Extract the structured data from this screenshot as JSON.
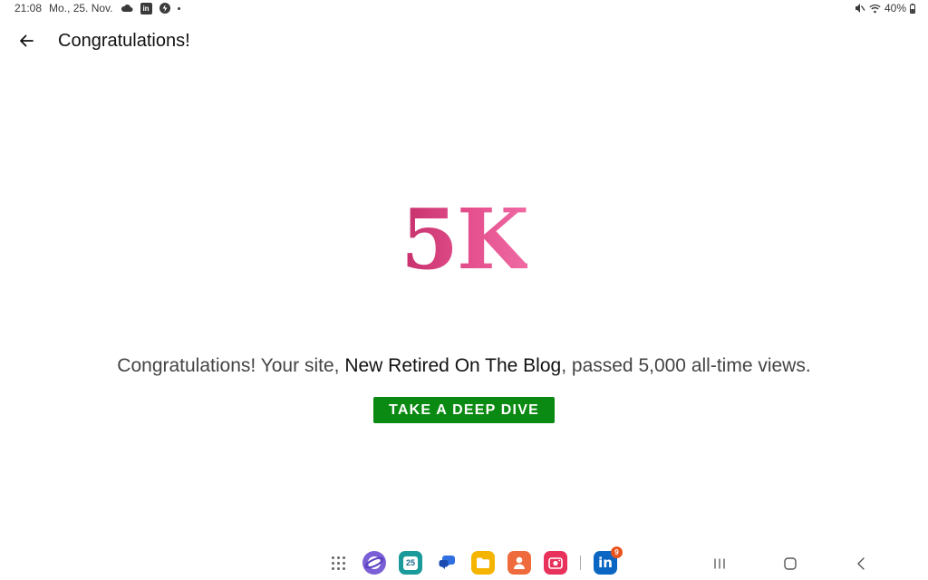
{
  "status_bar": {
    "time": "21:08",
    "date": "Mo., 25. Nov.",
    "notification_icons": [
      "cloud-icon",
      "linkedin-icon",
      "bolt-icon",
      "dot-icon"
    ],
    "battery": "40%",
    "system_icons": [
      "mute-icon",
      "wifi-icon",
      "battery-icon"
    ]
  },
  "app_bar": {
    "title": "Congratulations!"
  },
  "main": {
    "milestone": "5K",
    "message_prefix": "Congratulations! Your site,",
    "site_name": "New Retired On The Blog",
    "message_suffix": ", passed 5,000 all-time views.",
    "cta_label": "TAKE A DEEP DIVE"
  },
  "taskbar": {
    "apps": [
      {
        "name": "app-drawer-icon"
      },
      {
        "name": "samsung-internet-icon"
      },
      {
        "name": "calendar-icon",
        "label": "25"
      },
      {
        "name": "messages-icon"
      },
      {
        "name": "my-files-icon"
      },
      {
        "name": "contacts-icon"
      },
      {
        "name": "screen-recorder-icon"
      },
      {
        "name": "linkedin-app-icon",
        "badge": "9",
        "label": "in"
      }
    ],
    "nav": [
      "recents-icon",
      "home-icon",
      "back-nav-icon"
    ]
  },
  "colors": {
    "cta_green": "#0a8a12",
    "milestone_pink": "#e4508d"
  }
}
